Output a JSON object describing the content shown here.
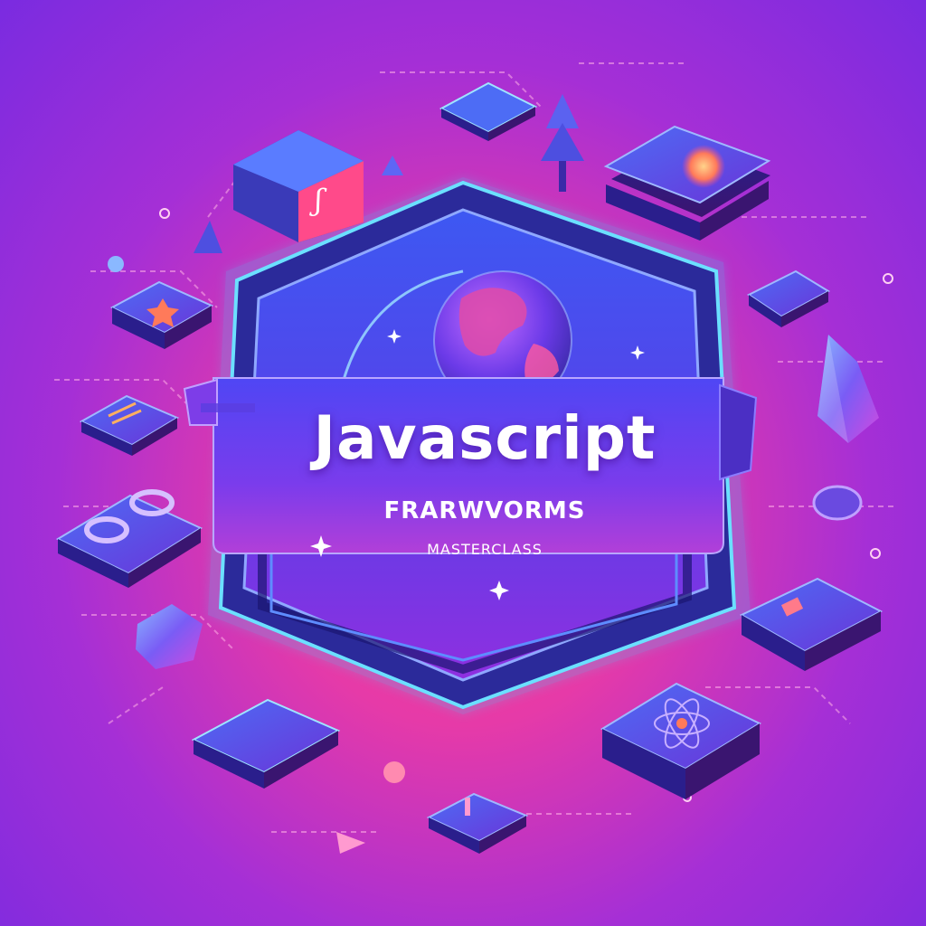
{
  "banner": {
    "title": "Javascript",
    "subtitle": "FRARWVORMS",
    "tagline": "MASTERCLASS"
  },
  "colors": {
    "background_center": "#ff3d8f",
    "background_edge": "#7a2be0",
    "badge_blue": "#4a3df0",
    "badge_purple": "#7b2fe8",
    "accent_cyan": "#3ad6ff",
    "accent_orange": "#ff9a4a"
  },
  "icons": [
    "globe-icon",
    "gem-icon",
    "tree-icon",
    "atom-icon",
    "sparkle-icon"
  ]
}
